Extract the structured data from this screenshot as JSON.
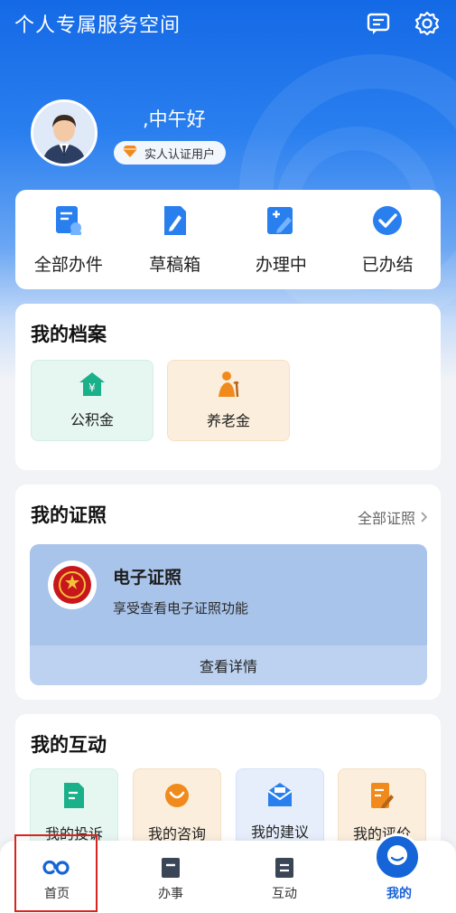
{
  "header": {
    "title": "个人专属服务空间",
    "icons": [
      "chat-icon",
      "gear-icon"
    ]
  },
  "profile": {
    "greeting": ",中午好",
    "badge": "实人认证用户"
  },
  "quick_actions": [
    {
      "label": "全部办件",
      "icon": "all-cases-icon"
    },
    {
      "label": "草稿箱",
      "icon": "draft-icon"
    },
    {
      "label": "办理中",
      "icon": "in-progress-icon"
    },
    {
      "label": "已办结",
      "icon": "done-check-icon"
    }
  ],
  "archive": {
    "title": "我的档案",
    "items": [
      {
        "label": "公积金",
        "icon": "housing-fund-icon"
      },
      {
        "label": "养老金",
        "icon": "pension-icon"
      }
    ]
  },
  "license": {
    "title": "我的证照",
    "all_link": "全部证照",
    "card_name": "电子证照",
    "card_desc": "享受查看电子证照功能",
    "detail_button": "查看详情"
  },
  "interact": {
    "title": "我的互动",
    "items": [
      {
        "label": "我的投诉",
        "icon": "complaint-icon"
      },
      {
        "label": "我的咨询",
        "icon": "consult-icon"
      },
      {
        "label": "我的建议",
        "icon": "suggestion-icon"
      },
      {
        "label": "我的评价",
        "icon": "review-icon"
      }
    ]
  },
  "tabbar": [
    {
      "label": "首页",
      "icon": "home-icon"
    },
    {
      "label": "办事",
      "icon": "service-icon"
    },
    {
      "label": "互动",
      "icon": "interact-icon"
    },
    {
      "label": "我的",
      "icon": "me-icon"
    }
  ],
  "colors": {
    "primary": "#1565d8",
    "highlight": "#d9231f",
    "green_accent": "#19b08a",
    "orange_accent": "#f08a1c"
  }
}
